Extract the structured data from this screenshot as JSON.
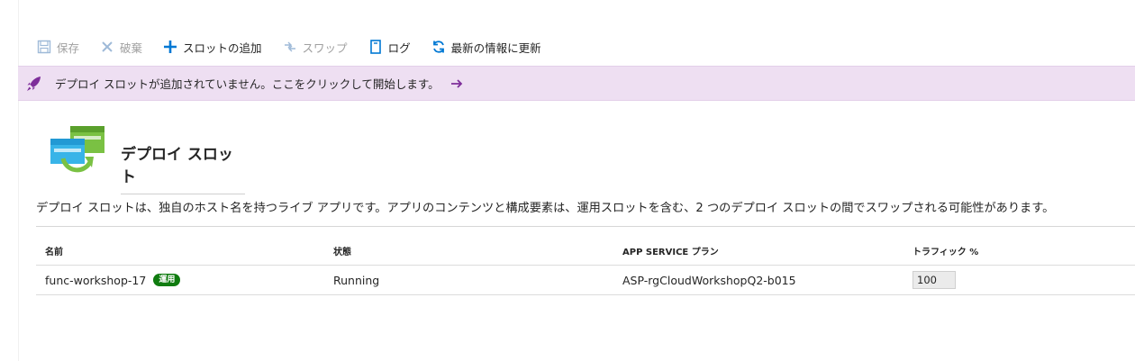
{
  "toolbar": {
    "save": "保存",
    "discard": "破棄",
    "add_slot": "スロットの追加",
    "swap": "スワップ",
    "log": "ログ",
    "refresh": "最新の情報に更新"
  },
  "notice": {
    "text": "デプロイ スロットが追加されていません。ここをクリックして開始します。",
    "background": "#eedff2",
    "accent": "#7e2e9a"
  },
  "hero": {
    "title": "デプロイ スロット",
    "description": "デプロイ スロットは、独自のホスト名を持つライブ アプリです。アプリのコンテンツと構成要素は、運用スロットを含む、2 つのデプロイ スロットの間でスワップされる可能性があります。"
  },
  "table": {
    "headers": {
      "name": "名前",
      "status": "状態",
      "plan": "APP SERVICE プラン",
      "traffic": "トラフィック %"
    },
    "rows": [
      {
        "name": "func-workshop-17",
        "badge": "運用",
        "status": "Running",
        "plan": "ASP-rgCloudWorkshopQ2-b015",
        "traffic": "100"
      }
    ]
  },
  "colors": {
    "primary_blue": "#0078d4",
    "badge_green": "#107c10",
    "disabled_gray": "#a0a0a0"
  }
}
